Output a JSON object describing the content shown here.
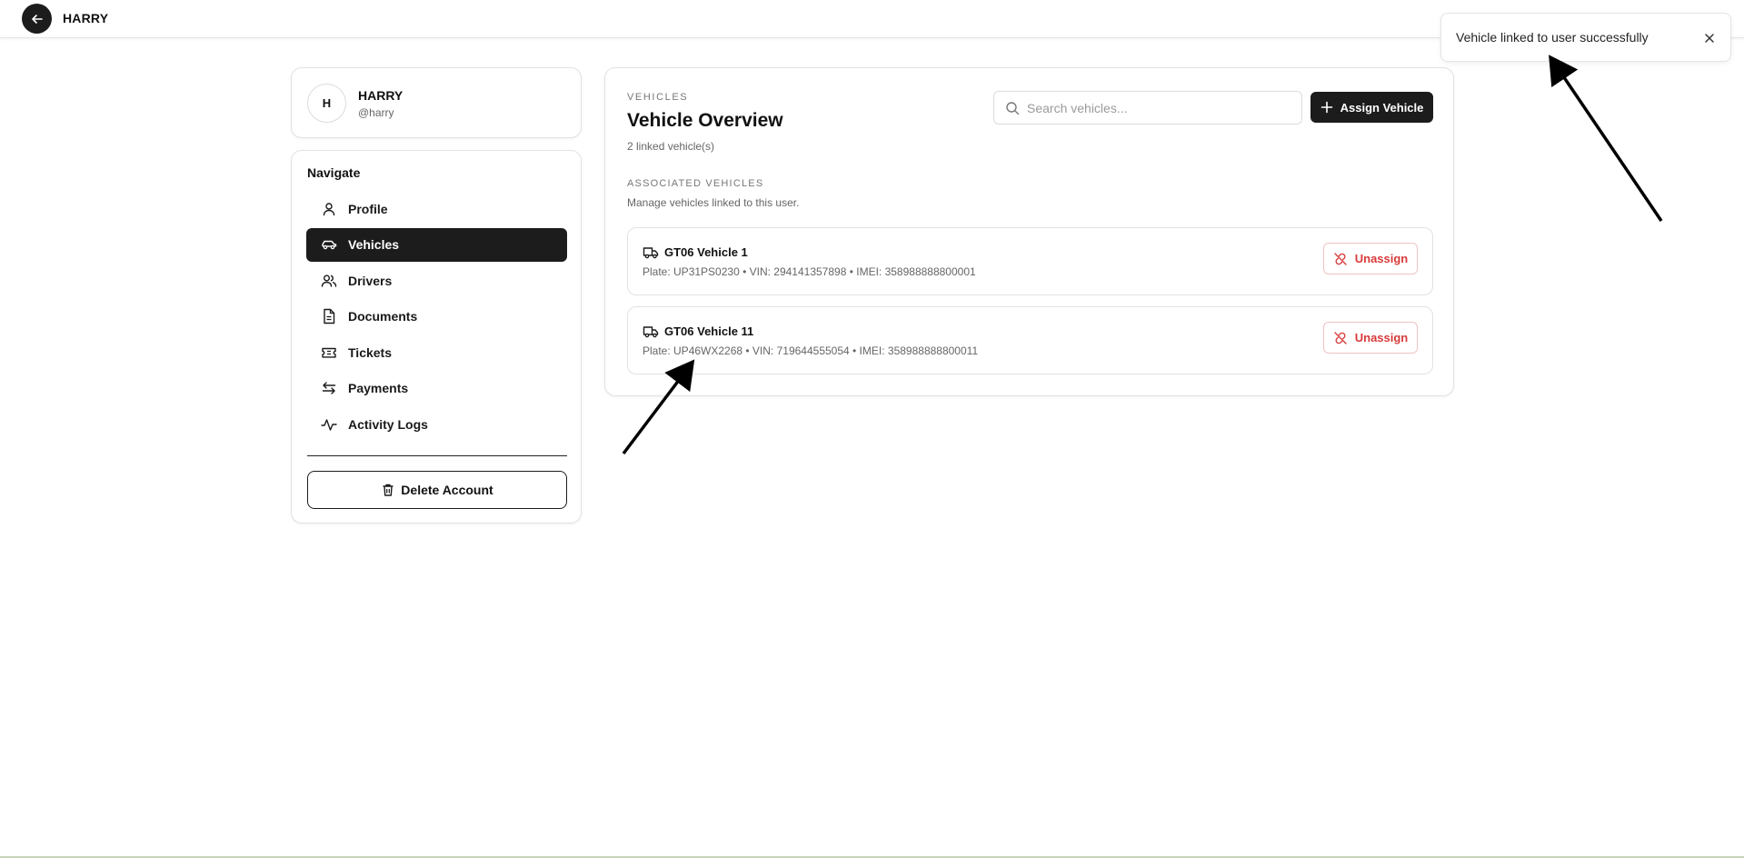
{
  "header": {
    "title": "HARRY"
  },
  "toast": {
    "message": "Vehicle linked to user successfully"
  },
  "profile": {
    "initial": "H",
    "name": "HARRY",
    "handle": "@harry"
  },
  "nav": {
    "heading": "Navigate",
    "items": [
      {
        "label": "Profile",
        "icon": "user-icon",
        "active": false
      },
      {
        "label": "Vehicles",
        "icon": "car-icon",
        "active": true
      },
      {
        "label": "Drivers",
        "icon": "users-icon",
        "active": false
      },
      {
        "label": "Documents",
        "icon": "document-icon",
        "active": false
      },
      {
        "label": "Tickets",
        "icon": "ticket-icon",
        "active": false
      },
      {
        "label": "Payments",
        "icon": "transfer-icon",
        "active": false
      },
      {
        "label": "Activity Logs",
        "icon": "activity-icon",
        "active": false
      }
    ],
    "delete_label": "Delete Account"
  },
  "main": {
    "eyebrow": "VEHICLES",
    "title": "Vehicle Overview",
    "linked_count": "2 linked vehicle(s)",
    "search_placeholder": "Search vehicles...",
    "assign_label": "Assign Vehicle",
    "section_label": "ASSOCIATED VEHICLES",
    "section_desc": "Manage vehicles linked to this user.",
    "vehicles": [
      {
        "name": "GT06 Vehicle 1",
        "meta": "Plate: UP31PS0230 • VIN: 294141357898 • IMEI: 358988888800001",
        "action": "Unassign"
      },
      {
        "name": "GT06 Vehicle 11",
        "meta": "Plate: UP46WX2268 • VIN: 719644555054 • IMEI: 358988888800011",
        "action": "Unassign"
      }
    ]
  },
  "colors": {
    "dark": "#1c1c1c",
    "danger": "#d93a3a",
    "danger_border": "#f0c3c3"
  }
}
